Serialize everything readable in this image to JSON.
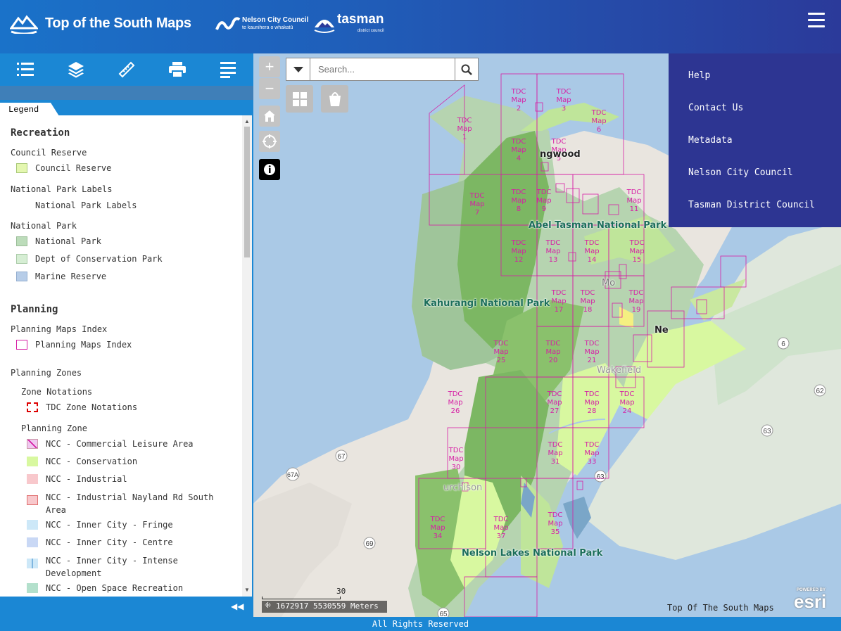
{
  "header": {
    "title": "Top of the South Maps",
    "ncc_name": "Nelson City Council",
    "ncc_tagline": "te kaunihera o whakatū",
    "tdc_name": "tasman",
    "tdc_sub": "district council"
  },
  "toolbar": {
    "icons": [
      "list-icon",
      "layers-icon",
      "ruler-icon",
      "print-icon",
      "menu-list-icon"
    ]
  },
  "panel": {
    "tab": "Legend"
  },
  "legend": {
    "sections": [
      {
        "title": "Recreation"
      },
      {
        "title": "Planning"
      }
    ],
    "groups": {
      "council_reserve": "Council Reserve",
      "np_labels": "National Park Labels",
      "national_park": "National Park",
      "planning_maps_index": "Planning Maps Index",
      "planning_zones": "Planning Zones",
      "zone_notations": "Zone Notations",
      "planning_zone": "Planning Zone"
    },
    "items": {
      "council_reserve": "Council Reserve",
      "np_labels": "National Park Labels",
      "national_park": "National Park",
      "conservation_park": "Dept of Conservation Park",
      "marine_reserve": "Marine Reserve",
      "planning_maps_index": "Planning Maps Index",
      "tdc_zone_notations": "TDC Zone Notations",
      "commercial_leisure": "NCC - Commercial Leisure Area",
      "conservation": "NCC - Conservation",
      "industrial": "NCC - Industrial",
      "industrial_nayland": "NCC - Industrial Nayland Rd South Area",
      "inner_city_fringe": "NCC - Inner City - Fringe",
      "inner_city_centre": "NCC - Inner City - Centre",
      "inner_city_intense": "NCC - Inner City - Intense Development",
      "open_space": "NCC - Open Space Recreation"
    },
    "colors": {
      "council_reserve": "#e4f7b0",
      "national_park": "#bcdcba",
      "conservation_park": "#d6eed4",
      "marine_reserve": "#b7cde8",
      "planning_maps_index": "#d61fa5",
      "conservation": "#d8f8a0",
      "industrial": "#f8c8cc",
      "inner_city_fringe": "#cde8f8",
      "inner_city_centre": "#c9d8f5",
      "open_space": "#b3e0cc"
    }
  },
  "search": {
    "placeholder": "Search..."
  },
  "menu": {
    "items": [
      "Help",
      "Contact Us",
      "Metadata",
      "Nelson City Council",
      "Tasman District Council"
    ]
  },
  "map": {
    "labels": {
      "abel_tasman": "Abel Tasman National Park",
      "kahurangi": "Kahurangi National Park",
      "nelson_lakes": "Nelson Lakes National Park",
      "collingwood": "ngwood",
      "motueka": "Mo",
      "nelson": "Ne",
      "wakefield": "Wakefield",
      "murchison": "urchison"
    },
    "map_sheets": [
      "1",
      "2",
      "3",
      "4",
      "5",
      "6",
      "7",
      "8",
      "9",
      "11",
      "12",
      "13",
      "14",
      "15",
      "17",
      "18",
      "19",
      "20",
      "21",
      "25",
      "26",
      "27",
      "28",
      "24",
      "30",
      "31",
      "33",
      "34",
      "35",
      "37"
    ],
    "map_prefix": "TDC",
    "map_word": "Map",
    "highways": [
      "6",
      "62",
      "63",
      "67",
      "67A",
      "69",
      "65",
      "63"
    ],
    "scale_text": "1672917 5530559 Meters",
    "scale_bar_label": "30",
    "attribution": "Top Of The South Maps",
    "esri_label": "esri",
    "esri_powered": "POWERED BY"
  },
  "footer": {
    "text": "All Rights Reserved"
  }
}
